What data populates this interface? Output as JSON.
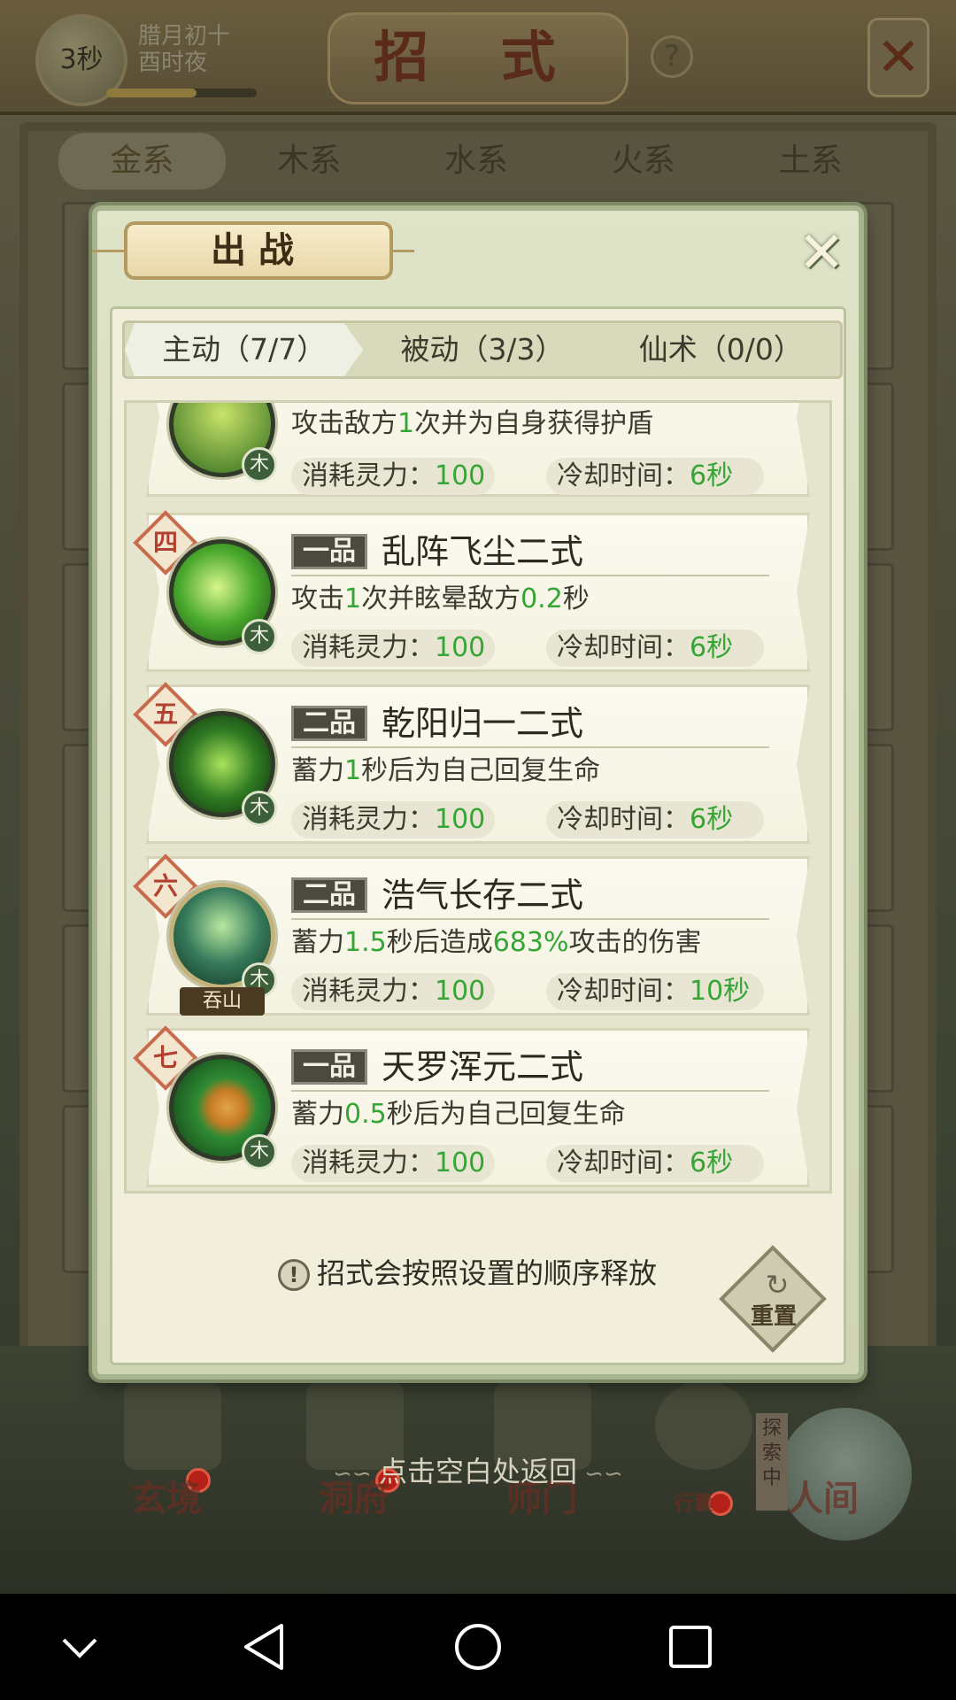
{
  "background": {
    "timer": "3秒",
    "date_line1": "腊月初十",
    "date_line2": "酉时夜",
    "title": "招 式",
    "help": "?",
    "element_tabs": [
      "金系",
      "木系",
      "水系",
      "火系",
      "土系"
    ],
    "bottom_nav": [
      "玄境",
      "洞府",
      "师门",
      "行囊",
      "人间"
    ],
    "explore_tag": "探索中"
  },
  "modal": {
    "title": "出战",
    "close_icon": "close-icon",
    "tabs": [
      {
        "label": "主动（7/7）",
        "active": true
      },
      {
        "label": "被动（3/3）",
        "active": false
      },
      {
        "label": "仙术（0/0）",
        "active": false
      }
    ],
    "skills": [
      {
        "rank": "",
        "element": "木",
        "grade": "",
        "name": "",
        "desc_parts": [
          "攻击敌方",
          "1",
          "次并为自身获得护盾"
        ],
        "cost_label": "消耗灵力：",
        "cost": "100",
        "cd_label": "冷却时间：",
        "cd": "6秒",
        "icon_color": "#6fb83a"
      },
      {
        "rank": "四",
        "element": "木",
        "grade": "一品",
        "name": "乱阵飞尘二式",
        "desc_parts": [
          "攻击",
          "1",
          "次并眩晕敌方",
          "0.2",
          "秒"
        ],
        "cost_label": "消耗灵力：",
        "cost": "100",
        "cd_label": "冷却时间：",
        "cd": "6秒",
        "icon_color": "#58b83a"
      },
      {
        "rank": "五",
        "element": "木",
        "grade": "二品",
        "name": "乾阳归一二式",
        "desc_parts": [
          "蓄力",
          "1",
          "秒后为自己回复生命"
        ],
        "cost_label": "消耗灵力：",
        "cost": "100",
        "cd_label": "冷却时间：",
        "cd": "6秒",
        "icon_color": "#3f8f2c"
      },
      {
        "rank": "六",
        "element": "木",
        "grade": "二品",
        "name": "浩气长存二式",
        "desc_parts": [
          "蓄力",
          "1.5",
          "秒后造成",
          "683%",
          "攻击的伤害"
        ],
        "cost_label": "消耗灵力：",
        "cost": "100",
        "cd_label": "冷却时间：",
        "cd": "10秒",
        "icon_color": "#2f6f4c",
        "sub_tag": "吞山"
      },
      {
        "rank": "七",
        "element": "木",
        "grade": "一品",
        "name": "天罗浑元二式",
        "desc_parts": [
          "蓄力",
          "0.5",
          "秒后为自己回复生命"
        ],
        "cost_label": "消耗灵力：",
        "cost": "100",
        "cd_label": "冷却时间：",
        "cd": "6秒",
        "icon_color": "#2e8a34"
      }
    ],
    "hint": "招式会按照设置的顺序释放",
    "hint_icon": "!",
    "reset_label": "重置"
  },
  "return_hint": "点击空白处返回",
  "colors": {
    "accent_green": "#35a536",
    "rank_red": "#c86b4d"
  }
}
